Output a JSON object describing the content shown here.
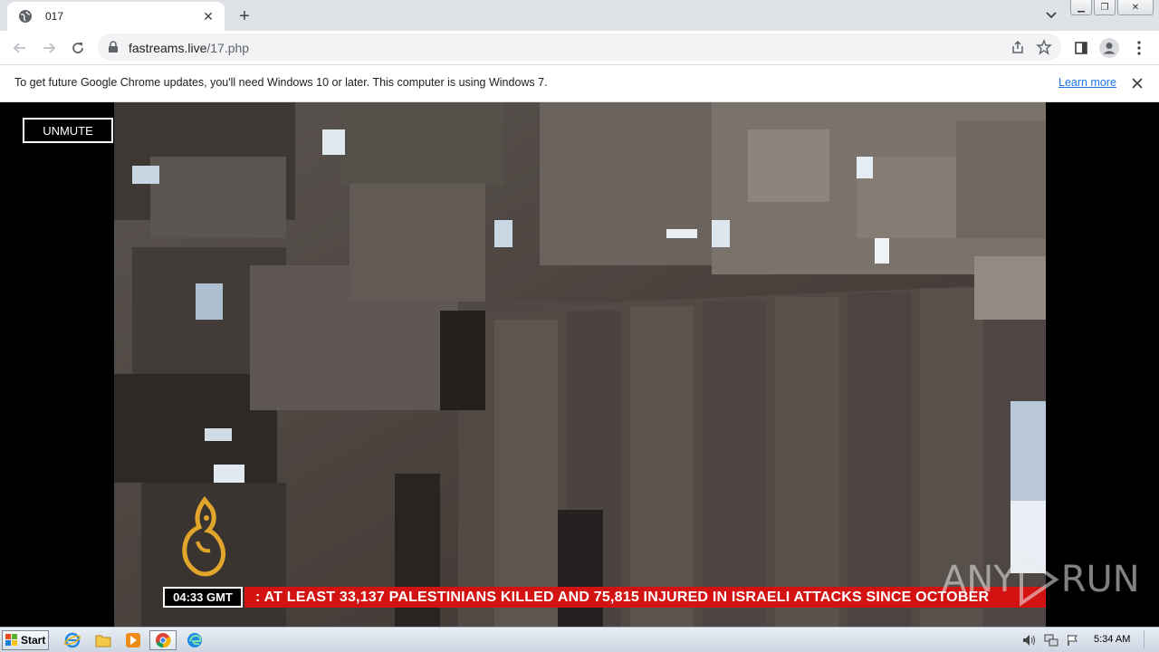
{
  "browser": {
    "tab": {
      "title": "017",
      "favicon": "globe-icon",
      "close_icon": "close-icon"
    },
    "new_tab_icon": "plus-icon",
    "tab_search_icon": "chevron-down-icon",
    "window_buttons": [
      "minimize-icon",
      "restore-icon",
      "close-icon"
    ],
    "toolbar": {
      "back_icon": "back-arrow-icon",
      "forward_icon": "forward-arrow-icon",
      "reload_icon": "reload-icon",
      "url_host": "fastreams.live",
      "url_path": "/17.php",
      "share_icon": "share-icon",
      "bookmark_icon": "star-icon",
      "side_panel_icon": "side-panel-icon",
      "profile_icon": "profile-icon",
      "menu_icon": "kebab-menu-icon"
    },
    "infobar": {
      "message": "To get future Google Chrome updates, you'll need Windows 10 or later. This computer is using Windows 7.",
      "link": "Learn more",
      "close_icon": "close-icon"
    }
  },
  "player": {
    "unmute_label": "UNMUTE",
    "time": "04:33 GMT",
    "ticker": ": AT LEAST 33,137 PALESTINIANS KILLED AND 75,815 INJURED IN ISRAELI ATTACKS SINCE OCTOBER",
    "channel_logo": "al-jazeera-logo",
    "watermark": "ANY RUN"
  },
  "taskbar": {
    "start_label": "Start",
    "apps": [
      "internet-explorer-icon",
      "file-explorer-icon",
      "media-player-icon",
      "chrome-icon",
      "edge-icon"
    ],
    "tray": [
      "volume-icon",
      "network-icon",
      "action-center-flag-icon"
    ],
    "clock": "5:34 AM"
  },
  "colors": {
    "ticker_red": "#d31212",
    "link_blue": "#1a73e8",
    "tab_strip": "#dee1e6"
  }
}
